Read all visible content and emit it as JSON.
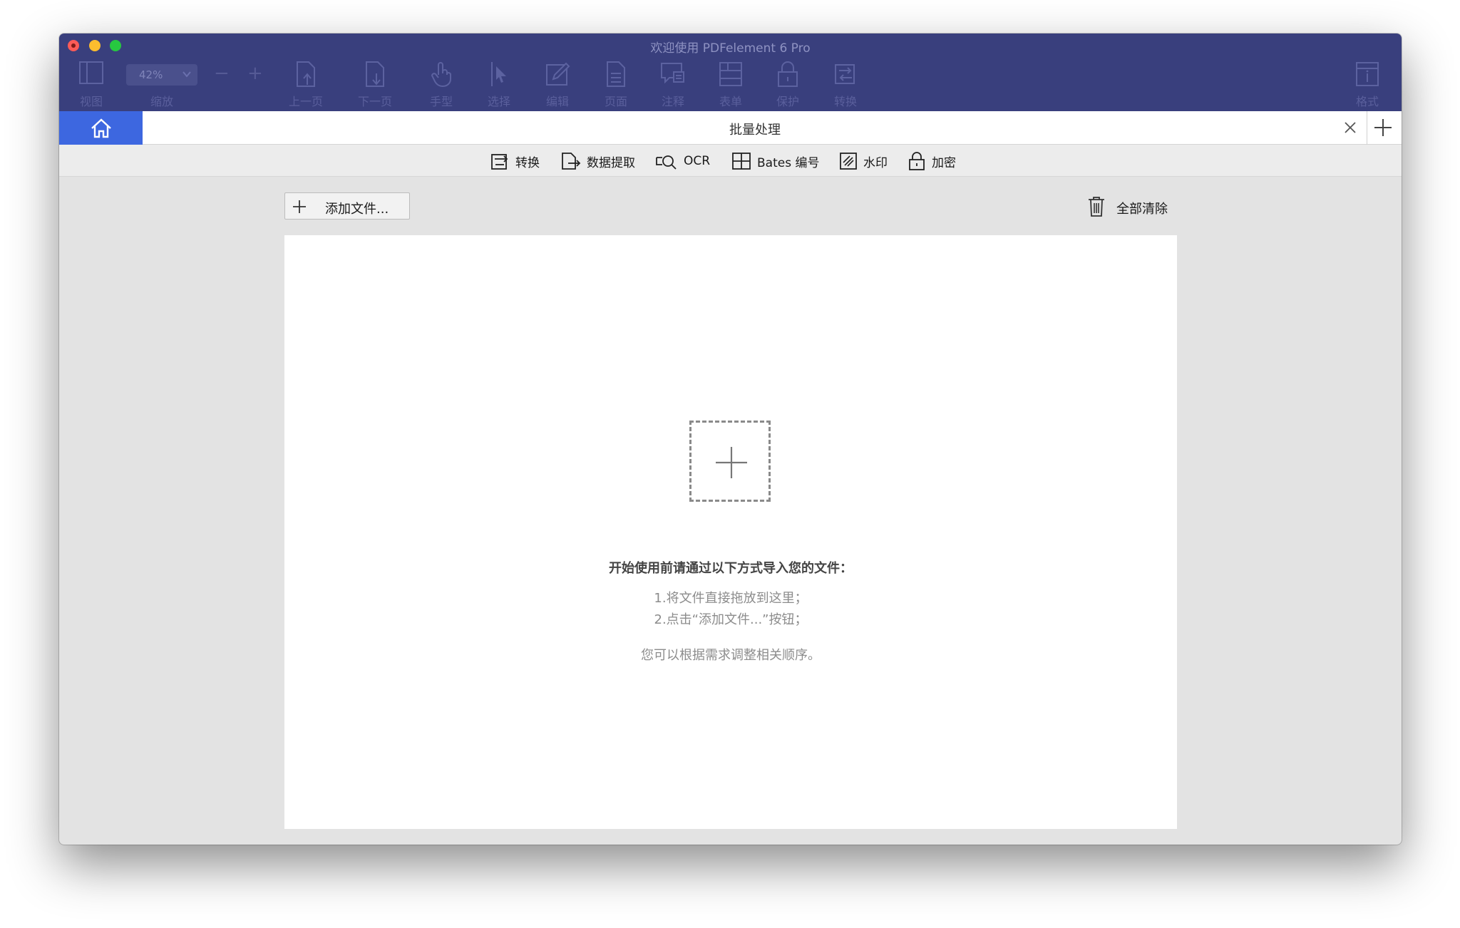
{
  "window": {
    "title": "欢迎使用 PDFelement 6 Pro"
  },
  "toolbar": {
    "view_label": "视图",
    "zoom_label": "缩放",
    "zoom_value": "42%",
    "zoom_out": "−",
    "zoom_in": "+",
    "prev_label": "上一页",
    "next_label": "下一页",
    "hand_label": "手型",
    "select_label": "选择",
    "edit_label": "编辑",
    "page_label": "页面",
    "comment_label": "注释",
    "form_label": "表单",
    "protect_label": "保护",
    "convert_label": "转换",
    "format_label": "格式"
  },
  "tabs": {
    "active_title": "批量处理"
  },
  "batch_menu": {
    "convert": "转换",
    "extract": "数据提取",
    "ocr": "OCR",
    "bates": "Bates 编号",
    "watermark": "水印",
    "encrypt": "加密"
  },
  "actions": {
    "add_files": "添加文件...",
    "clear_all": "全部清除"
  },
  "drop_area": {
    "title": "开始使用前请通过以下方式导入您的文件：",
    "step1": "1.将文件直接拖放到这里；",
    "step2": "2.点击“添加文件...”按钮；",
    "note": "您可以根据需求调整相关顺序。"
  },
  "colors": {
    "toolbar_bg": "#393f7d",
    "home_tab": "#3d67e0",
    "window_bg": "#e3e3e3"
  }
}
